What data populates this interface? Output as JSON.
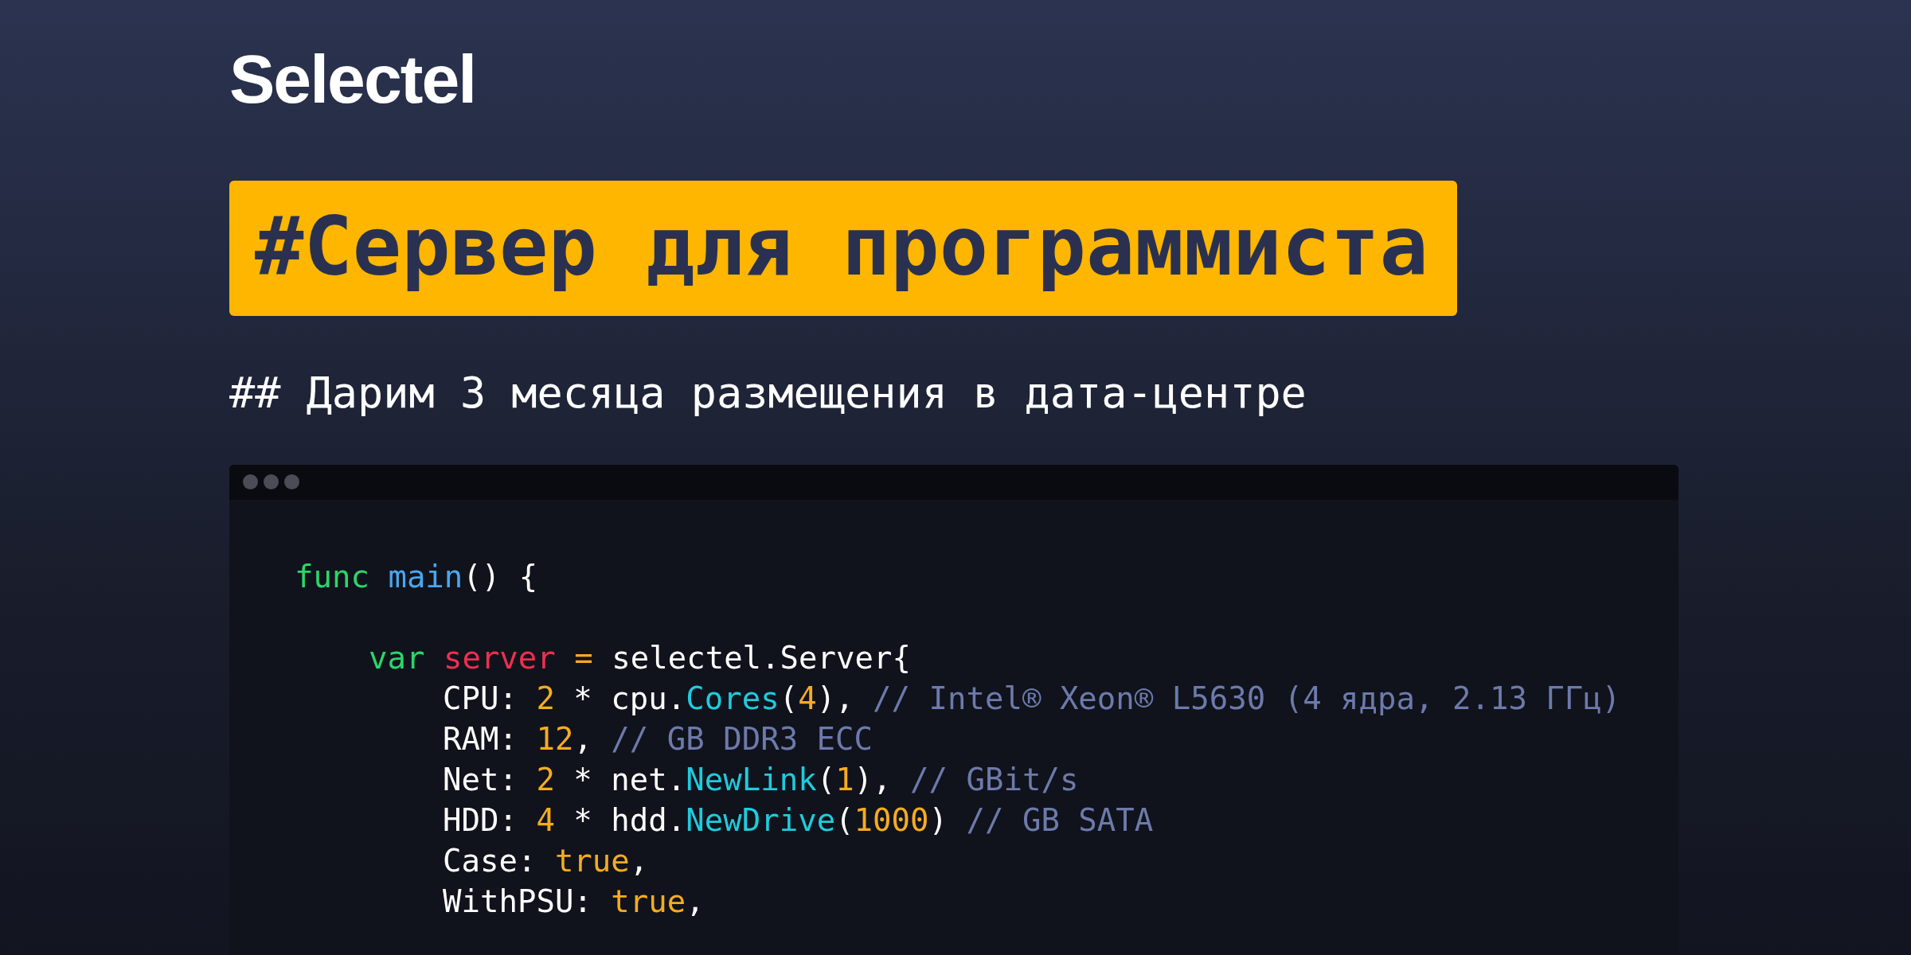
{
  "logo": {
    "text": "Selectel"
  },
  "headline": "#Сервер для программиста",
  "subtitle": "## Дарим 3 месяца размещения в дата-центре",
  "code_window": {
    "lines": [
      {
        "blank_before": false,
        "tokens": [
          {
            "kind": "keyword",
            "text": "func "
          },
          {
            "kind": "function",
            "text": "main"
          },
          {
            "kind": "plain",
            "text": "() {"
          }
        ],
        "children": [
          {
            "blank_before": true,
            "tokens": [
              {
                "kind": "keyword",
                "text": "var "
              },
              {
                "kind": "variable",
                "text": "server "
              },
              {
                "kind": "number",
                "text": "="
              },
              {
                "kind": "plain",
                "text": " selectel.Server{"
              }
            ],
            "children": [
              {
                "blank_before": false,
                "tokens": [
                  {
                    "kind": "plain",
                    "text": "CPU: "
                  },
                  {
                    "kind": "number",
                    "text": "2"
                  },
                  {
                    "kind": "plain",
                    "text": " * cpu."
                  },
                  {
                    "kind": "method",
                    "text": "Cores"
                  },
                  {
                    "kind": "plain",
                    "text": "("
                  },
                  {
                    "kind": "number",
                    "text": "4"
                  },
                  {
                    "kind": "plain",
                    "text": "), "
                  },
                  {
                    "kind": "comment",
                    "text": "// Intel® Xeon® L5630 (4 ядра, 2.13 ГГц)"
                  }
                ]
              },
              {
                "blank_before": false,
                "tokens": [
                  {
                    "kind": "plain",
                    "text": "RAM: "
                  },
                  {
                    "kind": "number",
                    "text": "12"
                  },
                  {
                    "kind": "plain",
                    "text": ", "
                  },
                  {
                    "kind": "comment",
                    "text": "// GB DDR3 ECC"
                  }
                ]
              },
              {
                "blank_before": false,
                "tokens": [
                  {
                    "kind": "plain",
                    "text": "Net: "
                  },
                  {
                    "kind": "number",
                    "text": "2"
                  },
                  {
                    "kind": "plain",
                    "text": " * net."
                  },
                  {
                    "kind": "method",
                    "text": "NewLink"
                  },
                  {
                    "kind": "plain",
                    "text": "("
                  },
                  {
                    "kind": "number",
                    "text": "1"
                  },
                  {
                    "kind": "plain",
                    "text": "), "
                  },
                  {
                    "kind": "comment",
                    "text": "// GBit/s"
                  }
                ]
              },
              {
                "blank_before": false,
                "tokens": [
                  {
                    "kind": "plain",
                    "text": "HDD: "
                  },
                  {
                    "kind": "number",
                    "text": "4"
                  },
                  {
                    "kind": "plain",
                    "text": " * hdd."
                  },
                  {
                    "kind": "method",
                    "text": "NewDrive"
                  },
                  {
                    "kind": "plain",
                    "text": "("
                  },
                  {
                    "kind": "number",
                    "text": "1000"
                  },
                  {
                    "kind": "plain",
                    "text": ") "
                  },
                  {
                    "kind": "comment",
                    "text": "// GB SATA"
                  }
                ]
              },
              {
                "blank_before": false,
                "tokens": [
                  {
                    "kind": "plain",
                    "text": "Case: "
                  },
                  {
                    "kind": "number",
                    "text": "true"
                  },
                  {
                    "kind": "plain",
                    "text": ","
                  }
                ]
              },
              {
                "blank_before": false,
                "tokens": [
                  {
                    "kind": "plain",
                    "text": "WithPSU: "
                  },
                  {
                    "kind": "number",
                    "text": "true"
                  },
                  {
                    "kind": "plain",
                    "text": ","
                  }
                ]
              }
            ]
          }
        ]
      }
    ]
  }
}
